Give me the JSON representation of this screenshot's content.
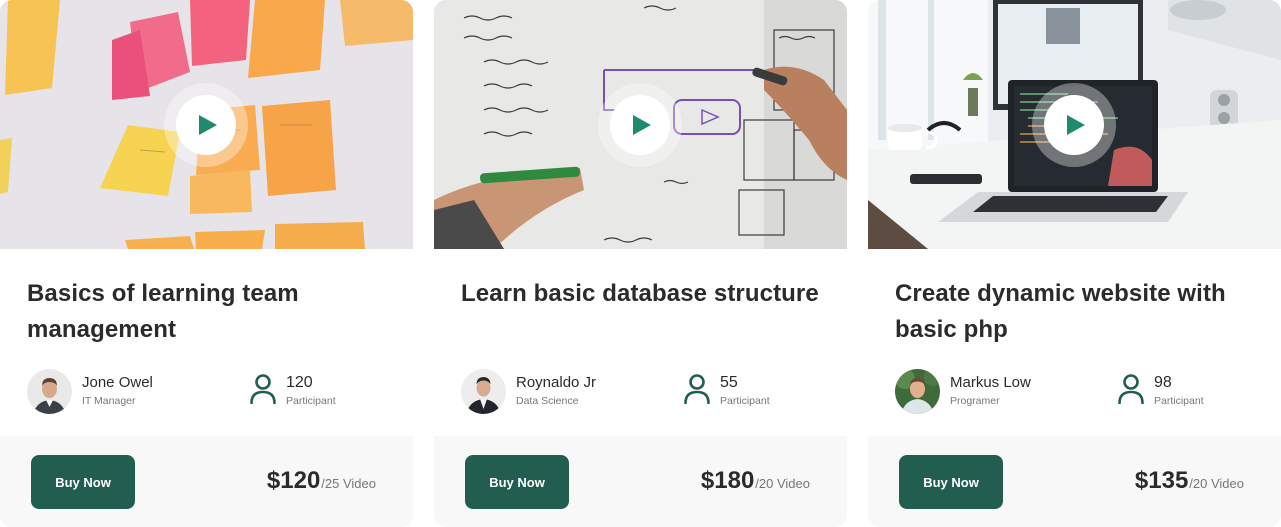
{
  "colors": {
    "accent": "#215e4f",
    "play_icon": "#1e8a6e",
    "title": "#2b2b2b",
    "muted": "#777777",
    "footer_bg": "#f8f8f8"
  },
  "courses": [
    {
      "image": "sticky-notes-wall-photo",
      "title": "Basics of learning team management",
      "instructor": {
        "name": "Jone Owel",
        "role": "IT Manager"
      },
      "participants": {
        "count": "120",
        "label": "Participant"
      },
      "buy_label": "Buy Now",
      "price": "$120",
      "per": "/25 Video"
    },
    {
      "image": "whiteboard-planning-photo",
      "title": "Learn basic database structure",
      "instructor": {
        "name": "Roynaldo Jr",
        "role": "Data Science"
      },
      "participants": {
        "count": "55",
        "label": "Participant"
      },
      "buy_label": "Buy Now",
      "price": "$180",
      "per": "/20 Video"
    },
    {
      "image": "laptop-desk-photo",
      "title": "Create dynamic website with basic php",
      "instructor": {
        "name": "Markus Low",
        "role": "Programer"
      },
      "participants": {
        "count": "98",
        "label": "Participant"
      },
      "buy_label": "Buy Now",
      "price": "$135",
      "per": "/20 Video"
    }
  ]
}
